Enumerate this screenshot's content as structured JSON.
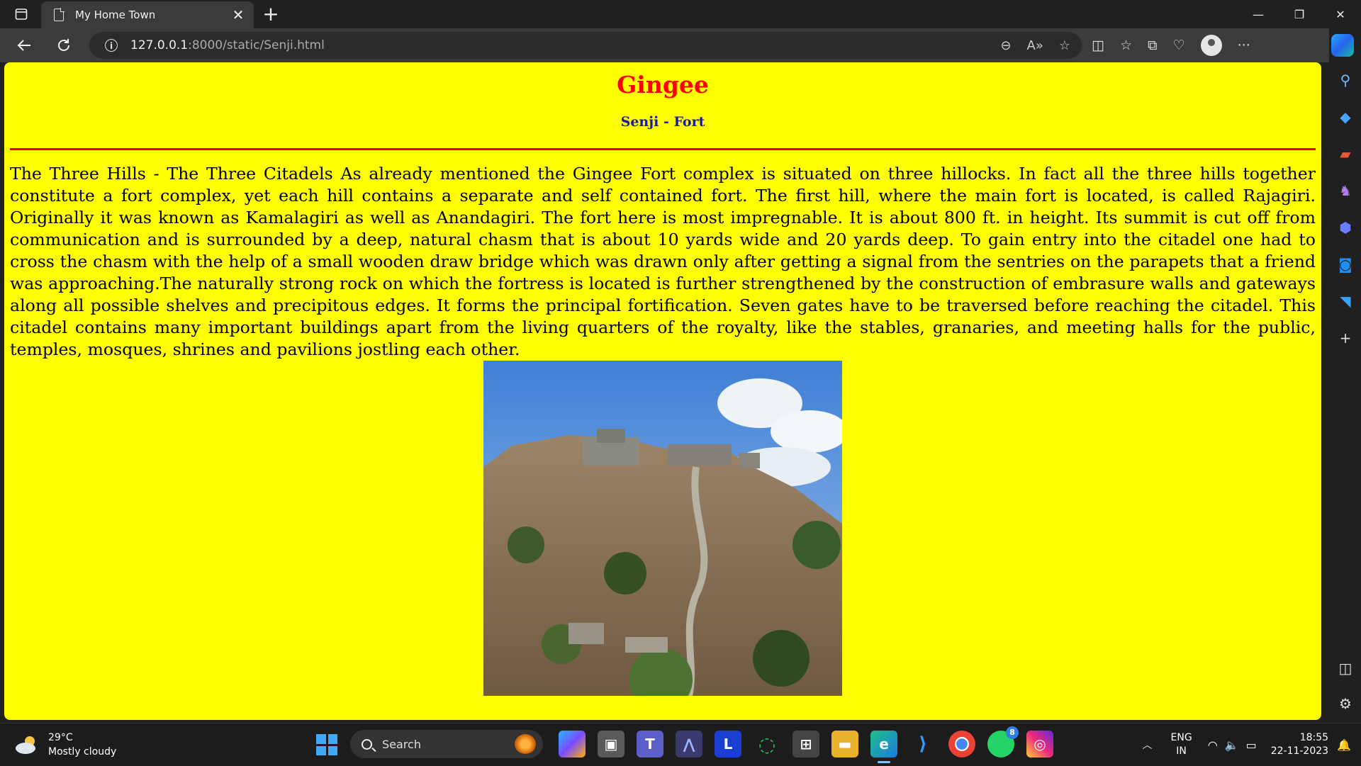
{
  "browser": {
    "tab_title": "My Home Town",
    "url_host": "127.0.0.1",
    "url_path": ":8000/static/Senji.html"
  },
  "page": {
    "title": "Gingee",
    "subtitle": "Senji - Fort",
    "body": "The Three Hills - The Three Citadels As already mentioned the Gingee Fort complex is situated on three hillocks. In fact all the three hills together constitute a fort complex, yet each hill contains a separate and self contained fort. The first hill, where the main fort is located, is called Rajagiri. Originally it was known as Kamalagiri as well as Anandagiri. The fort here is most impregnable. It is about 800 ft. in height. Its summit is cut off from communication and is surrounded by a deep, natural chasm that is about 10 yards wide and 20 yards deep. To gain entry into the citadel one had to cross the chasm with the help of a small wooden draw bridge which was drawn only after getting a signal from the sentries on the parapets that a friend was approaching.The naturally strong rock on which the fortress is located is further strengthened by the construction of embrasure walls and gateways along all possible shelves and precipitous edges. It forms the principal fortification. Seven gates have to be traversed before reaching the citadel. This citadel contains many important buildings apart from the living quarters of the royalty, like the stables, granaries, and meeting halls for the public, temples, mosques, shrines and pavilions jostling each other.",
    "colors": {
      "background": "#ffff00",
      "title": "#ff0000",
      "subtitle": "#1a1aa6",
      "rule": "#e30000"
    }
  },
  "taskbar": {
    "weather_temp": "29°C",
    "weather_desc": "Mostly cloudy",
    "search_label": "Search",
    "lang_line1": "ENG",
    "lang_line2": "IN",
    "time": "18:55",
    "date": "22-11-2023",
    "whatsapp_badge": "8"
  }
}
